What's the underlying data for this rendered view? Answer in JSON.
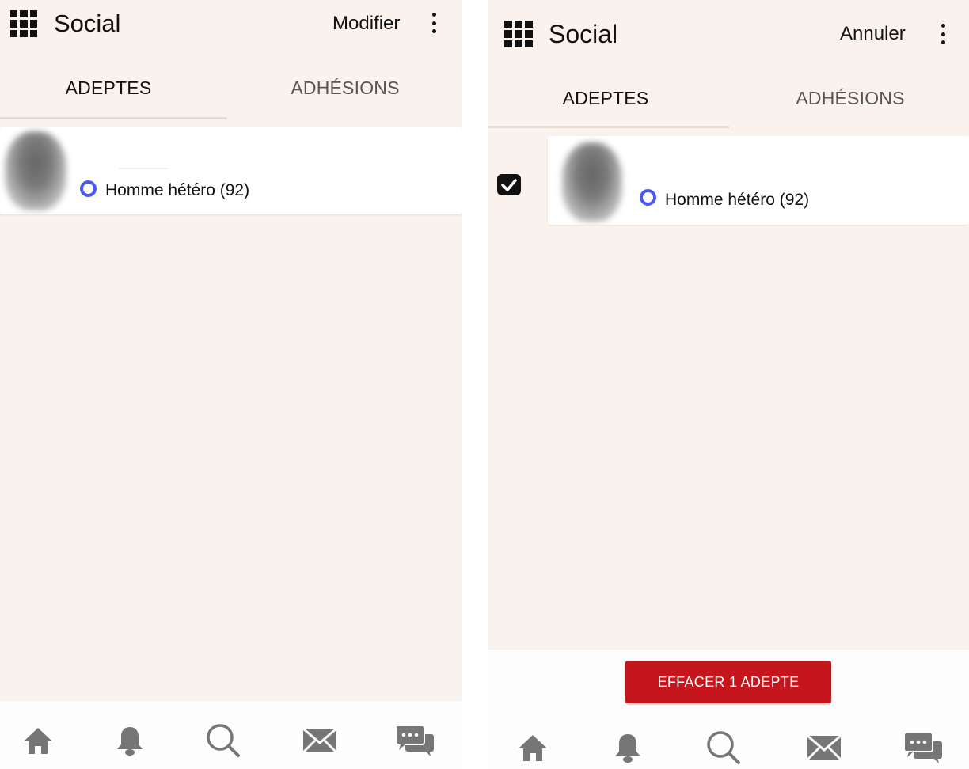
{
  "colors": {
    "background": "#faf2ec",
    "status_ring": "#4759f0",
    "delete_button": "#c4161c"
  },
  "screens": [
    {
      "app_title": "Social",
      "action_label": "Modifier",
      "tabs": [
        "ADEPTES",
        "ADHÉSIONS"
      ],
      "active_tab": "ADEPTES",
      "list": [
        {
          "orientation": "Homme hétéro (92)",
          "selected": false
        }
      ]
    },
    {
      "app_title": "Social",
      "action_label": "Annuler",
      "tabs": [
        "ADEPTES",
        "ADHÉSIONS"
      ],
      "active_tab": "ADEPTES",
      "list": [
        {
          "orientation": "Homme hétéro (92)",
          "selected": true
        }
      ],
      "delete_button_label": "EFFACER 1 ADEPTE"
    }
  ],
  "bottom_nav": [
    "home-icon",
    "bell-icon",
    "search-icon",
    "mail-icon",
    "chat-icon"
  ]
}
